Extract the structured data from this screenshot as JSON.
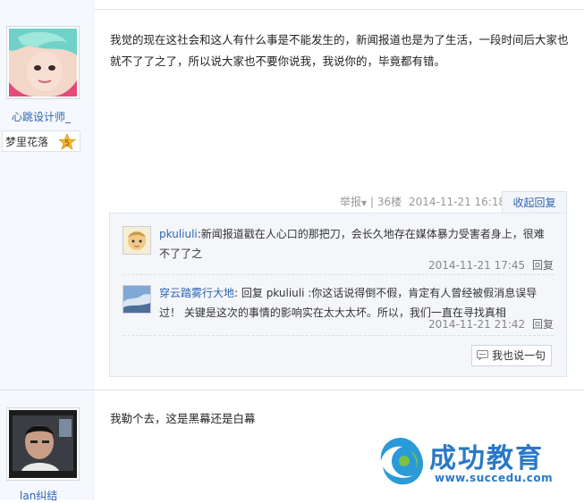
{
  "post1": {
    "username": "心跳设计师_",
    "badge_text": "梦里花落",
    "badge_level": "5",
    "content": "我觉的现在这社会和这人有什么事是不能发生的，新闻报道也是为了生活，一段时间后大家也就不了了之了，所以说大家也不要你说我，我说你的，毕竟都有错。",
    "meta": {
      "report": "举报",
      "report_arrow": "▼",
      "sep": "|",
      "floor": "36楼",
      "time": "2014-11-21 16:18"
    },
    "collapse_label": "收起回复",
    "replies": [
      {
        "user": "pkuliuli",
        "text": ":新闻报道戳在人心口的那把刀，会长久地存在媒体暴力受害者身上，很难不了了之",
        "time": "2014-11-21 17:45",
        "reply_label": "回复"
      },
      {
        "user": "穿云踏雾行大地",
        "text": ": 回复 pkuliuli :你这话说得倒不假，肯定有人曾经被假消息误导过！ 关键是这次的事情的影响实在太大太坏。所以，我们一直在寻找真相",
        "time": "2014-11-21 21:42",
        "reply_label": "回复"
      }
    ],
    "say_label": "我也说一句"
  },
  "post2": {
    "username": "lan纠结",
    "content": "我勒个去，这是黑幕还是白幕"
  },
  "watermark": {
    "name": "成功教育",
    "url": "www.succedu.com"
  },
  "colors": {
    "link": "#2d64b3",
    "sidebar_bg": "#f5f8fc",
    "reply_bg": "#f4f6f9",
    "logo": "#2a78c6"
  }
}
